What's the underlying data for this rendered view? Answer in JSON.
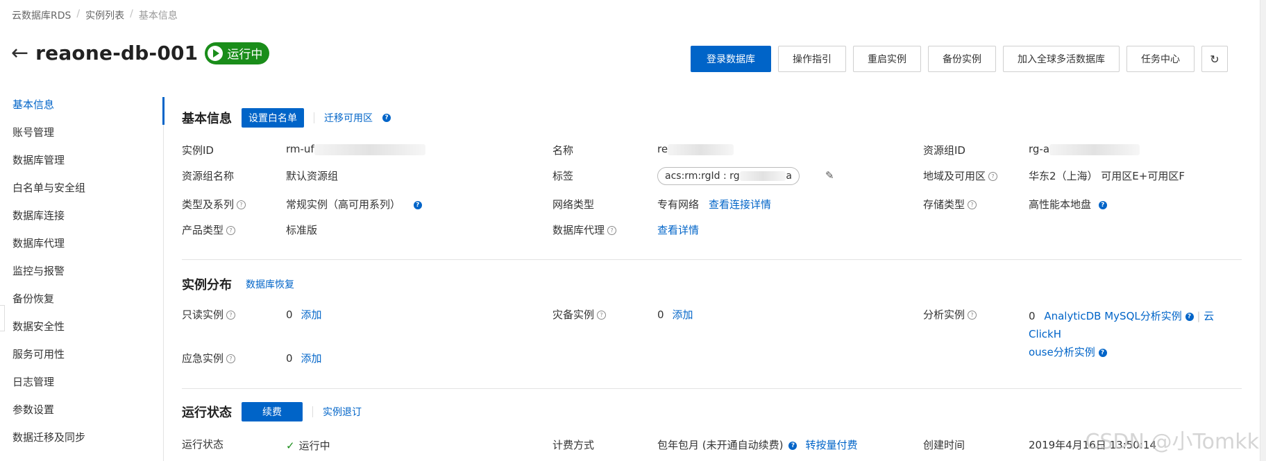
{
  "breadcrumb": [
    "云数据库RDS",
    "实例列表",
    "基本信息"
  ],
  "header": {
    "title": "reaone-db-001",
    "status": "运行中"
  },
  "top_actions": [
    "登录数据库",
    "操作指引",
    "重启实例",
    "备份实例",
    "加入全球多活数据库",
    "任务中心"
  ],
  "refresh_icon": "↻",
  "sidebar": {
    "items": [
      "基本信息",
      "账号管理",
      "数据库管理",
      "白名单与安全组",
      "数据库连接",
      "数据库代理",
      "监控与报警",
      "备份恢复",
      "数据安全性",
      "服务可用性",
      "日志管理",
      "参数设置",
      "数据迁移及同步"
    ]
  },
  "basic": {
    "title": "基本信息",
    "whitelist_btn": "设置白名单",
    "migrate_link": "迁移可用区",
    "instance_id_label": "实例ID",
    "instance_id_value": "rm-uf",
    "name_label": "名称",
    "name_value": "re",
    "rg_id_label": "资源组ID",
    "rg_id_value": "rg-a",
    "rg_name_label": "资源组名称",
    "rg_name_value": "默认资源组",
    "tag_label": "标签",
    "tag_value": "acs:rm:rgId : rg",
    "tag_tail": "a",
    "region_label": "地域及可用区",
    "region_value": "华东2（上海） 可用区E+可用区F",
    "type_label": "类型及系列",
    "type_value": "常规实例（高可用系列）",
    "network_label": "网络类型",
    "network_value": "专有网络",
    "network_link": "查看连接详情",
    "storage_label": "存储类型",
    "storage_value": "高性能本地盘",
    "product_label": "产品类型",
    "product_value": "标准版",
    "proxy_label": "数据库代理",
    "proxy_link": "查看详情"
  },
  "distribution": {
    "title": "实例分布",
    "restore_link": "数据库恢复",
    "readonly_label": "只读实例",
    "readonly_count": "0",
    "add": "添加",
    "dr_label": "灾备实例",
    "dr_count": "0",
    "analytics_label": "分析实例",
    "analytics_count": "0",
    "analytics_link1": "AnalyticDB MySQL分析实例",
    "analytics_link2a": "云ClickH",
    "analytics_link2b": "ouse分析实例",
    "emergency_label": "应急实例",
    "emergency_count": "0"
  },
  "running": {
    "title": "运行状态",
    "renew_btn": "续费",
    "refund_link": "实例退订",
    "status_label": "运行状态",
    "status_value": "运行中",
    "billing_label": "计费方式",
    "billing_value": "包年包月 (未开通自动续费)",
    "billing_link": "转按量付费",
    "created_label": "创建时间",
    "created_value": "2019年4月16日 13:50:14"
  },
  "watermark": "CSDN @小Tomkk"
}
